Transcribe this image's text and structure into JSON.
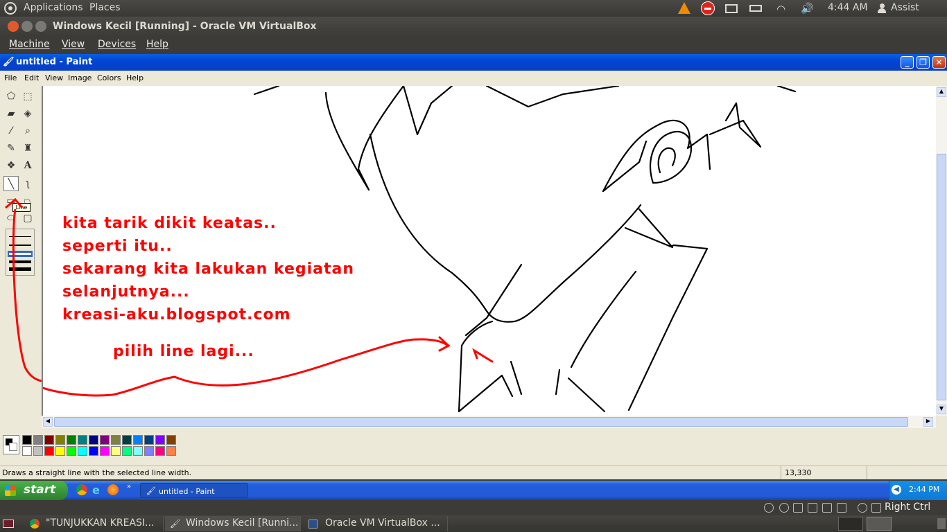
{
  "top_panel": {
    "applications": "Applications",
    "places": "Places",
    "time": "4:44 AM",
    "user": "Assist",
    "icons": [
      "ubuntu-logo-icon",
      "vlc-icon",
      "stop-icon",
      "mail-icon",
      "battery-icon",
      "wifi-icon",
      "volume-icon",
      "user-icon"
    ]
  },
  "vbox": {
    "title": "Windows Kecil [Running] - Oracle VM VirtualBox",
    "menu": [
      "Machine",
      "View",
      "Devices",
      "Help"
    ],
    "host_key": "Right Ctrl"
  },
  "paint": {
    "title": "untitled - Paint",
    "menu": [
      "File",
      "Edit",
      "View",
      "Image",
      "Colors",
      "Help"
    ],
    "tooltip": "Line",
    "status_text": "Draws a straight line with the selected line width.",
    "coords": "13,330",
    "palette_top": [
      "#000000",
      "#808080",
      "#800000",
      "#808000",
      "#008000",
      "#008080",
      "#000080",
      "#800080",
      "#808040",
      "#004040",
      "#0080ff",
      "#004080",
      "#8000ff",
      "#804000"
    ],
    "palette_bottom": [
      "#ffffff",
      "#c0c0c0",
      "#ff0000",
      "#ffff00",
      "#00ff00",
      "#00ffff",
      "#0000ff",
      "#ff00ff",
      "#ffff80",
      "#00ff80",
      "#80ffff",
      "#8080ff",
      "#ff0080",
      "#ff8040"
    ]
  },
  "annotations": {
    "line1": "kita tarik dikit keatas..",
    "line2": "seperti itu..",
    "line3": "sekarang kita lakukan kegiatan",
    "line4": "selanjutnya...",
    "line5": "kreasi-aku.blogspot.com",
    "line6": "pilih line lagi..."
  },
  "xp_taskbar": {
    "start": "start",
    "task": "untitled - Paint",
    "time": "2:44 PM"
  },
  "bottom_panel": {
    "tasks": [
      "\"TUNJUKKAN KREASI...",
      "Windows Kecil [Runni...",
      "Oracle VM VirtualBox ..."
    ]
  }
}
